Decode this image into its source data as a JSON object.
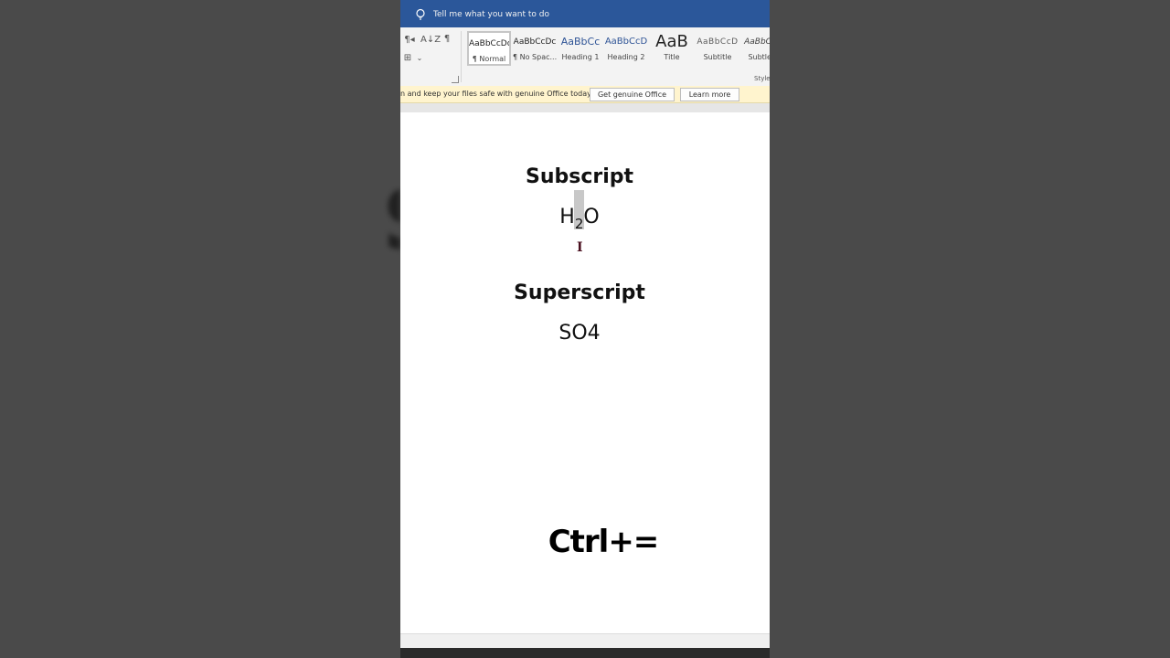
{
  "background_glyph": "S",
  "titlebar": {
    "tell_me": "Tell me what you want to do"
  },
  "ribbon": {
    "paragraph_buttons": {
      "rtl": "¶◂",
      "sort": "A↓Z",
      "pilcrow": "¶",
      "borders": "⊞",
      "borders_arrow": "⌄"
    },
    "styles": [
      {
        "preview": "AaBbCcDc",
        "name": "¶ Normal"
      },
      {
        "preview": "AaBbCcDc",
        "name": "¶ No Spac..."
      },
      {
        "preview": "AaBbCc",
        "name": "Heading 1"
      },
      {
        "preview": "AaBbCcD",
        "name": "Heading 2"
      },
      {
        "preview": "AaB",
        "name": "Title"
      },
      {
        "preview": "AaBbCcD",
        "name": "Subtitle"
      },
      {
        "preview": "AaBbCcD",
        "name": "Subtle E"
      }
    ],
    "styles_group_label": "Styles"
  },
  "activation_bar": {
    "message": "n and keep your files safe with genuine Office today.",
    "get_genuine": "Get genuine Office",
    "learn_more": "Learn more"
  },
  "document": {
    "subscript_heading": "Subscript",
    "h2o": {
      "h": "H",
      "sub": "2",
      "o": "O"
    },
    "cursor": "I",
    "superscript_heading": "Superscript",
    "so4": "SO4",
    "shortcut": "Ctrl+="
  },
  "colors": {
    "titlebar": "#2b579a",
    "activation_bar": "#fff4ce",
    "outer_background": "#4a4a4a",
    "selection_highlight": "#c8c8c8"
  }
}
